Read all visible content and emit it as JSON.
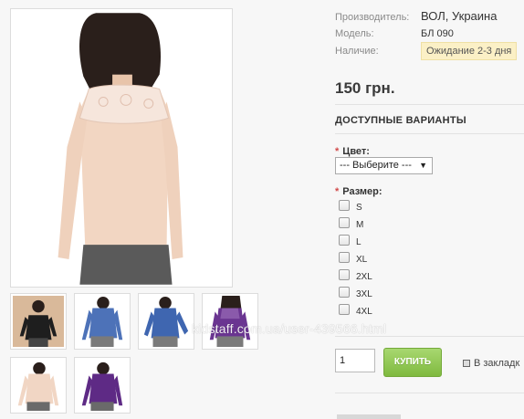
{
  "product": {
    "manufacturer_label": "Производитель:",
    "manufacturer_value": "ВОЛ, Украина",
    "model_label": "Модель:",
    "model_value": "БЛ 090",
    "availability_label": "Наличие:",
    "availability_value": "Ожидание 2-3 дня",
    "price": "150 грн."
  },
  "variants": {
    "title": "ДОСТУПНЫЕ ВАРИАНТЫ",
    "color_label": "Цвет:",
    "color_selected": "--- Выберите ---",
    "size_label": "Размер:",
    "sizes": [
      "S",
      "M",
      "L",
      "XL",
      "2XL",
      "3XL",
      "4XL"
    ],
    "required_mark": "*"
  },
  "purchase": {
    "quantity_value": "1",
    "buy_label": "КУПИТЬ",
    "bookmark_label": "В закладк"
  },
  "gallery": {
    "watermark": "kidstaff.com.ua/user-439566.html",
    "thumb_colors": [
      "#1e1e1e",
      "#4d72b8",
      "#3f66b0",
      "#6a3591",
      "#f1d6c4",
      "#5e2a85"
    ],
    "main_color": "#f2d6c2"
  }
}
